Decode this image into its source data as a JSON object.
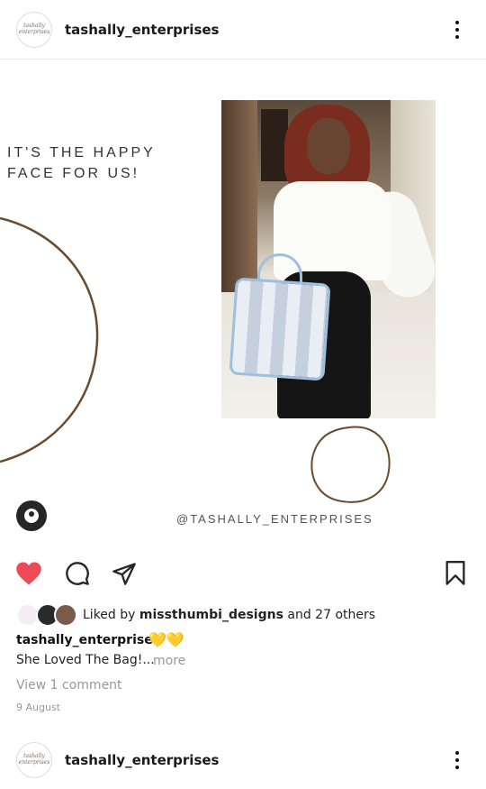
{
  "post": {
    "username": "tashally_enterprises",
    "avatar_text": "tashally enterprises",
    "image": {
      "quote": "IT'S THE HAPPY\nFACE FOR US!",
      "handle": "@TASHALLY_ENTERPRISES"
    },
    "likes": {
      "prefix": "Liked by ",
      "user": "missthumbi_designs",
      "suffix": " and 27 others"
    },
    "caption": {
      "username": "tashally_enterprises",
      "emoji": "💛💛",
      "text": "She Loved The Bag!...",
      "more": "more"
    },
    "view_comments": "View 1 comment",
    "date": "9 August"
  },
  "next_post": {
    "username": "tashally_enterprises",
    "avatar_text": "tashally enterprises"
  },
  "colors": {
    "like_red": "#ed4956",
    "curve_brown": "#6b4a2e",
    "icon_dark": "#262626"
  },
  "icons": [
    "kebab-menu-icon",
    "heart-icon",
    "comment-icon",
    "share-icon",
    "bookmark-icon",
    "user-tag-icon"
  ]
}
